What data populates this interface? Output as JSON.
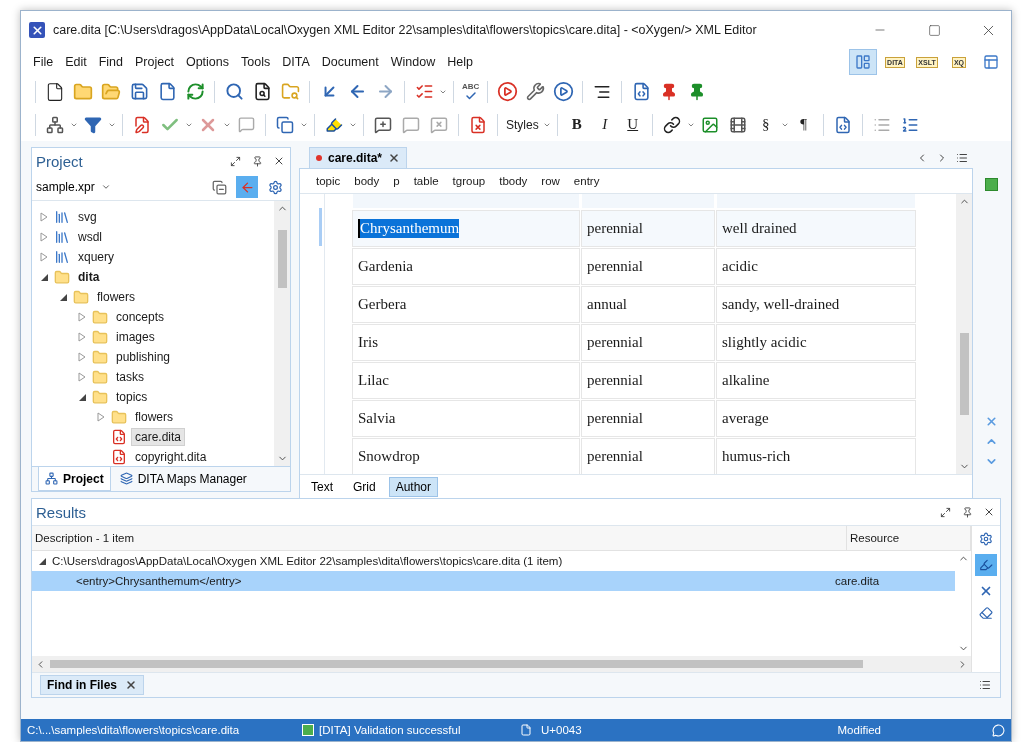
{
  "window": {
    "title": "care.dita [C:\\Users\\dragos\\AppData\\Local\\Oxygen XML Editor 22\\samples\\dita\\flowers\\topics\\care.dita] - <oXygen/> XML Editor"
  },
  "menu": [
    "File",
    "Edit",
    "Find",
    "Project",
    "Options",
    "Tools",
    "DITA",
    "Document",
    "Window",
    "Help"
  ],
  "perspectives": [
    {
      "selected": true
    },
    {
      "label": "DITA",
      "selected": false
    },
    {
      "label": "XSLT",
      "selected": false
    },
    {
      "label": "XQ",
      "selected": false
    },
    {
      "selected": false
    }
  ],
  "toolbar": {
    "spellcheck": "ABC",
    "styles": "Styles",
    "format": [
      "B",
      "I",
      "U"
    ],
    "symbols": [
      "§",
      "¶"
    ]
  },
  "project": {
    "title": "Project",
    "project_file": "sample.xpr",
    "tree": [
      {
        "label": "svg",
        "kind": "library",
        "expanded": false
      },
      {
        "label": "wsdl",
        "kind": "library",
        "expanded": false
      },
      {
        "label": "xquery",
        "kind": "library",
        "expanded": false
      },
      {
        "label": "dita",
        "kind": "folder",
        "expanded": true,
        "bold": true,
        "children": [
          {
            "label": "flowers",
            "kind": "folder",
            "expanded": true,
            "children": [
              {
                "label": "concepts",
                "kind": "folder",
                "expanded": false
              },
              {
                "label": "images",
                "kind": "folder",
                "expanded": false
              },
              {
                "label": "publishing",
                "kind": "folder",
                "expanded": false
              },
              {
                "label": "tasks",
                "kind": "folder",
                "expanded": false
              },
              {
                "label": "topics",
                "kind": "folder",
                "expanded": true,
                "children": [
                  {
                    "label": "flowers",
                    "kind": "folder",
                    "expanded": false
                  },
                  {
                    "label": "care.dita",
                    "kind": "file",
                    "selected": true
                  },
                  {
                    "label": "copyright.dita",
                    "kind": "file",
                    "selected": false
                  }
                ]
              }
            ]
          }
        ]
      }
    ],
    "tabs": [
      {
        "label": "Project",
        "selected": true
      },
      {
        "label": "DITA Maps Manager",
        "selected": false
      }
    ]
  },
  "editor": {
    "tabs": [
      {
        "label": "care.dita*",
        "selected": true,
        "modified": true
      }
    ],
    "breadcrumb": [
      "topic",
      "body",
      "p",
      "table",
      "tgroup",
      "tbody",
      "row",
      "entry"
    ],
    "rows": [
      {
        "cells": [
          "Chrysanthemum",
          "perennial",
          "well drained"
        ],
        "selected": true
      },
      {
        "cells": [
          "Gardenia",
          "perennial",
          "acidic"
        ],
        "selected": false
      },
      {
        "cells": [
          "Gerbera",
          "annual",
          "sandy, well-drained"
        ],
        "selected": false
      },
      {
        "cells": [
          "Iris",
          "perennial",
          "slightly acidic"
        ],
        "selected": false
      },
      {
        "cells": [
          "Lilac",
          "perennial",
          "alkaline"
        ],
        "selected": false
      },
      {
        "cells": [
          "Salvia",
          "perennial",
          "average"
        ],
        "selected": false
      },
      {
        "cells": [
          "Snowdrop",
          "perennial",
          "humus-rich"
        ],
        "selected": false
      }
    ],
    "modes": [
      {
        "label": "Text",
        "selected": false
      },
      {
        "label": "Grid",
        "selected": false
      },
      {
        "label": "Author",
        "selected": true
      }
    ]
  },
  "results": {
    "title": "Results",
    "columns": [
      "Description - 1 item",
      "Resource"
    ],
    "groups": [
      {
        "label": "C:\\Users\\dragos\\AppData\\Local\\Oxygen XML Editor 22\\samples\\dita\\flowers\\topics\\care.dita (1 item)",
        "expanded": true,
        "items": [
          {
            "description": "<entry>Chrysanthemum</entry>",
            "resource": "care.dita",
            "selected": true
          }
        ]
      }
    ],
    "tabs": [
      {
        "label": "Find in Files",
        "selected": true
      }
    ]
  },
  "status_bar": {
    "path": "C:\\...\\samples\\dita\\flowers\\topics\\care.dita",
    "validation": "[DITA] Validation successful",
    "valid": true,
    "character": "U+0043",
    "state": "Modified"
  }
}
